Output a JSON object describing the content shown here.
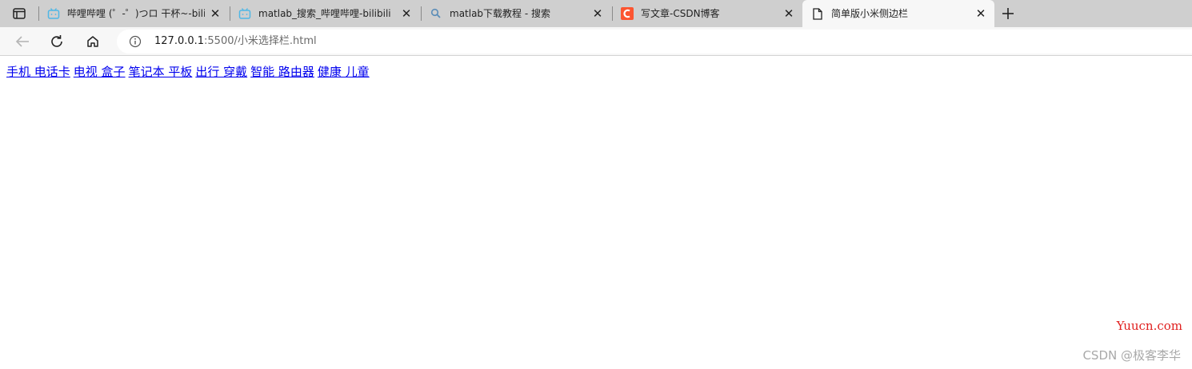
{
  "tabs": [
    {
      "title": "哔哩哔哩 (゜-゜)つロ 干杯~-bilibili",
      "icon": "bilibili-tv-icon",
      "active": false
    },
    {
      "title": "matlab_搜索_哔哩哔哩-bilibili",
      "icon": "bilibili-tv-icon",
      "active": false
    },
    {
      "title": "matlab下载教程 - 搜索",
      "icon": "search-icon",
      "active": false
    },
    {
      "title": "写文章-CSDN博客",
      "icon": "csdn-logo-icon",
      "active": false
    },
    {
      "title": "简单版小米侧边栏",
      "icon": "page-icon",
      "active": true
    }
  ],
  "toolbar": {
    "url_host": "127.0.0.1",
    "url_path": ":5500/小米选择栏.html"
  },
  "page": {
    "links": [
      {
        "label": "手机 电话卡"
      },
      {
        "label": "电视 盒子"
      },
      {
        "label": "笔记本 平板"
      },
      {
        "label": "出行 穿戴"
      },
      {
        "label": "智能 路由器"
      },
      {
        "label": "健康 儿童"
      }
    ]
  },
  "watermarks": {
    "site": "Yuucn.com",
    "author": "CSDN @极客李华"
  },
  "colors": {
    "tabstrip_bg": "#cfcfcf",
    "toolbar_bg": "#f7f7f7",
    "link": "#0000ee",
    "csdn_brand": "#fc5531",
    "bilibili_icon": "#4fb7e6"
  }
}
